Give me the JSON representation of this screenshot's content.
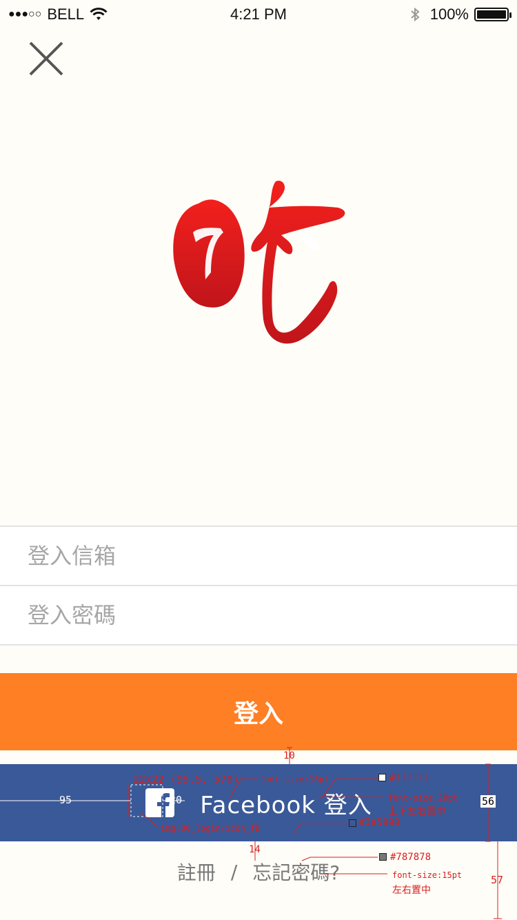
{
  "status_bar": {
    "signal": "●●●○○",
    "carrier": "BELL",
    "time": "4:21 PM",
    "battery": "100%"
  },
  "icons": {
    "close": "close-icon",
    "logo": "eat-logo",
    "facebook": "facebook-icon",
    "wifi": "wifi-icon",
    "bluetooth": "bluetooth-icon"
  },
  "form": {
    "email_placeholder": "登入信箱",
    "password_placeholder": "登入密碼"
  },
  "buttons": {
    "login": "登入",
    "facebook_login": "Facebook 登入"
  },
  "links": {
    "register": "註冊",
    "separator": "/",
    "forgot": "忘記密碼?"
  },
  "colors": {
    "background": "#fffdf7",
    "login_button": "#ff7f24",
    "facebook_button": "#3a5998",
    "link_text": "#787878",
    "logo_red": "#e8211e"
  },
  "annotations": {
    "fb_icon_spec": "22x22 (95.5, 570)",
    "fb_icon_asset": "img:00_login/icon_fb",
    "font_18": "font-size:18pt",
    "white_hex": "#ffffff",
    "font_20": "font-size:20pt",
    "center_all": "上下左右置中",
    "fb_hex": "#3a5998",
    "gray_hex": "#787878",
    "font_15": "font-size:15pt",
    "center_h": "左右置中",
    "d10": "10",
    "d95": "95",
    "d20": "20",
    "d56": "56",
    "d14": "14",
    "d57": "57"
  }
}
